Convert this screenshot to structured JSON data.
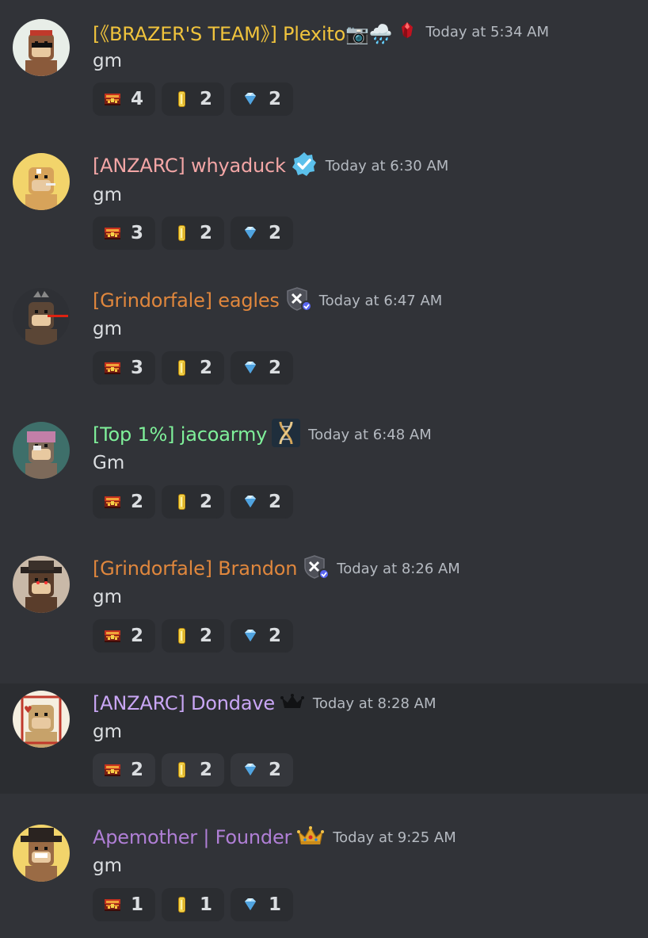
{
  "messages": [
    {
      "username": "[《BRAZER'S TEAM》] Plexito📷🌧️",
      "name_color": "#f0c33c",
      "badge": "ruby-gem-icon",
      "timestamp": "Today at 5:34 AM",
      "text": "gm",
      "avatar_bg": "#e8eee8",
      "reactions": [
        {
          "icon": "treasure-chest-icon",
          "count": "4"
        },
        {
          "icon": "gold-coin-icon",
          "count": "2"
        },
        {
          "icon": "diamond-icon",
          "count": "2"
        }
      ]
    },
    {
      "username": "[ANZARC] whyaduck",
      "name_color": "#f3a6a6",
      "badge": "verified-check-icon",
      "timestamp": "Today at 6:30 AM",
      "text": "gm",
      "avatar_bg": "#f2d46b",
      "reactions": [
        {
          "icon": "treasure-chest-icon",
          "count": "3"
        },
        {
          "icon": "gold-coin-icon",
          "count": "2"
        },
        {
          "icon": "diamond-icon",
          "count": "2"
        }
      ]
    },
    {
      "username": "[Grindorfale] eagles",
      "name_color": "#e0873d",
      "badge": "shield-tools-icon",
      "timestamp": "Today at 6:47 AM",
      "text": "gm",
      "avatar_bg": "#2e3035",
      "reactions": [
        {
          "icon": "treasure-chest-icon",
          "count": "3"
        },
        {
          "icon": "gold-coin-icon",
          "count": "2"
        },
        {
          "icon": "diamond-icon",
          "count": "2"
        }
      ]
    },
    {
      "username": "[Top 1%] jacoarmy",
      "name_color": "#7ff09a",
      "badge": "dna-icon",
      "timestamp": "Today at 6:48 AM",
      "text": "Gm",
      "avatar_bg": "#3e6f6a",
      "reactions": [
        {
          "icon": "treasure-chest-icon",
          "count": "2"
        },
        {
          "icon": "gold-coin-icon",
          "count": "2"
        },
        {
          "icon": "diamond-icon",
          "count": "2"
        }
      ]
    },
    {
      "username": "[Grindorfale] Brandon",
      "name_color": "#e0873d",
      "badge": "shield-tools-icon",
      "timestamp": "Today at 8:26 AM",
      "text": "gm",
      "avatar_bg": "#c9b9a8",
      "reactions": [
        {
          "icon": "treasure-chest-icon",
          "count": "2"
        },
        {
          "icon": "gold-coin-icon",
          "count": "2"
        },
        {
          "icon": "diamond-icon",
          "count": "2"
        }
      ]
    },
    {
      "username": "[ANZARC] Dondave",
      "name_color": "#c9a6f5",
      "badge": "crown-black-icon",
      "timestamp": "Today at 8:28 AM",
      "text": "gm",
      "avatar_bg": "#f5efe0",
      "reactions": [
        {
          "icon": "treasure-chest-icon",
          "count": "2"
        },
        {
          "icon": "gold-coin-icon",
          "count": "2"
        },
        {
          "icon": "diamond-icon",
          "count": "2"
        }
      ]
    },
    {
      "username": "Apemother | Founder",
      "name_color": "#b07fd6",
      "badge": "crown-gold-icon",
      "timestamp": "Today at 9:25 AM",
      "text": "gm",
      "avatar_bg": "#f2d46b",
      "reactions": [
        {
          "icon": "treasure-chest-icon",
          "count": "1"
        },
        {
          "icon": "gold-coin-icon",
          "count": "1"
        },
        {
          "icon": "diamond-icon",
          "count": "1"
        }
      ]
    }
  ]
}
